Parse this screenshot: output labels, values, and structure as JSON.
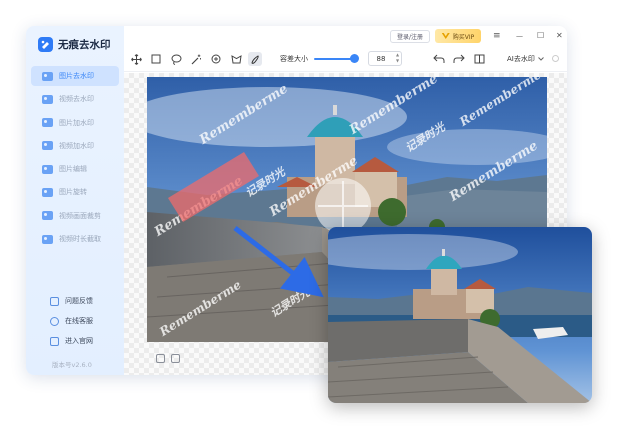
{
  "app": {
    "title": "无痕去水印",
    "version": "版本号v2.6.0"
  },
  "sidebar": {
    "items": [
      {
        "label": "图片去水印",
        "icon": "image-icon",
        "active": true
      },
      {
        "label": "视频去水印",
        "icon": "video-icon",
        "active": false
      },
      {
        "label": "图片加水印",
        "icon": "image-add-icon",
        "active": false
      },
      {
        "label": "视频加水印",
        "icon": "video-add-icon",
        "active": false
      },
      {
        "label": "图片编辑",
        "icon": "image-edit-icon",
        "active": false
      },
      {
        "label": "图片旋转",
        "icon": "rotate-icon",
        "active": false
      },
      {
        "label": "视频画面裁剪",
        "icon": "crop-icon",
        "active": false
      },
      {
        "label": "视频时长截取",
        "icon": "clip-icon",
        "active": false
      }
    ],
    "support": [
      {
        "label": "问题反馈",
        "icon": "feedback-icon"
      },
      {
        "label": "在线客服",
        "icon": "support-icon"
      },
      {
        "label": "进入官网",
        "icon": "website-icon"
      }
    ]
  },
  "topbar": {
    "login_label": "登录/注册",
    "vip_label": "购买VIP",
    "menu_icon": "≡",
    "minimize_icon": "—",
    "maximize_icon": "☐",
    "close_icon": "✕"
  },
  "toolbar": {
    "brush_size_label": "容差大小",
    "brush_size_value": "88",
    "brush_size_fraction": 0.88,
    "ai_label": "AI去水印",
    "tools": [
      "move-icon",
      "rect-select-icon",
      "lasso-icon",
      "magic-wand-icon",
      "smart-select-icon",
      "polygon-icon",
      "brush-icon"
    ]
  },
  "watermark": {
    "cn": "记录时光",
    "en": "Rememberme"
  },
  "colors": {
    "accent": "#3a86f7",
    "sidebar_bg": "#e6f0ff",
    "vip_gold": "#ffd46a",
    "arrow": "#2d6be6",
    "selection": "#ef6b6b"
  }
}
